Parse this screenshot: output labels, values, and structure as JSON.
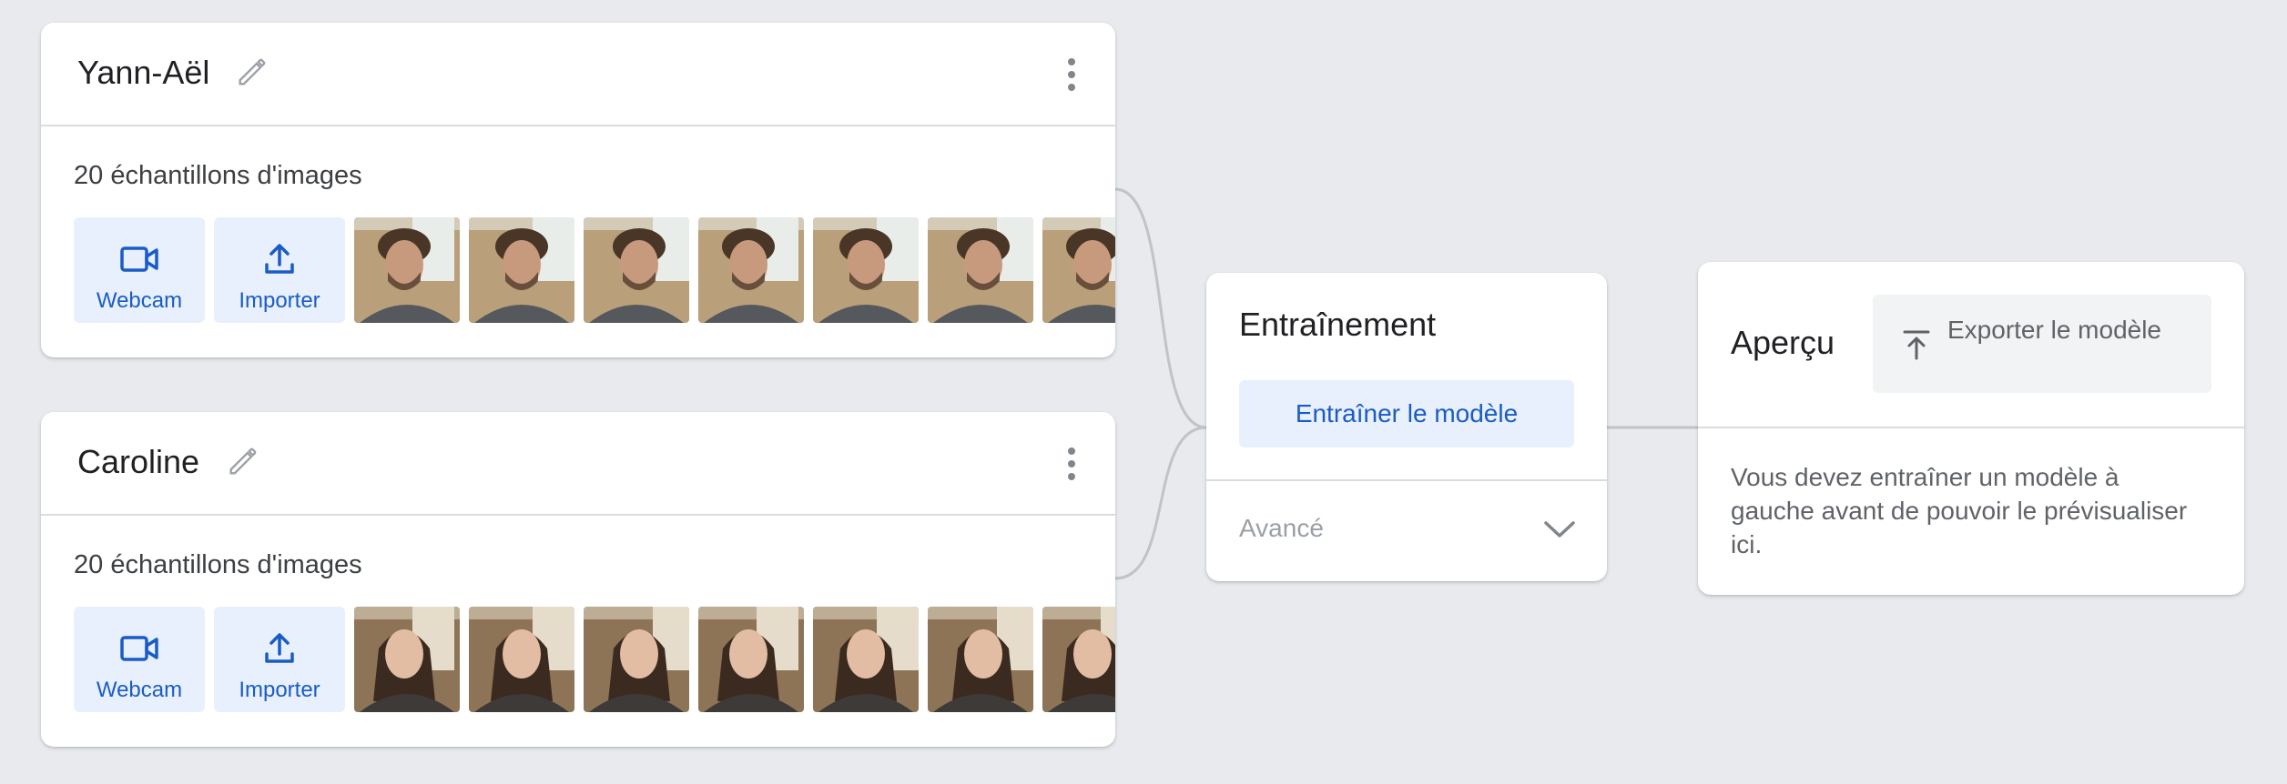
{
  "classes": [
    {
      "name": "Yann-Aël",
      "samples_label": "20 échantillons d'images",
      "webcam_label": "Webcam",
      "upload_label": "Importer",
      "thumb_count": 7,
      "thumb_palette": {
        "bg": "#b9a07a",
        "bg2": "#e9ede9",
        "skin": "#c79a7d",
        "hair": "#4a3626",
        "shirt": "#55585c"
      }
    },
    {
      "name": "Caroline",
      "samples_label": "20 échantillons d'images",
      "webcam_label": "Webcam",
      "upload_label": "Importer",
      "thumb_count": 7,
      "thumb_palette": {
        "bg": "#8e7456",
        "bg2": "#e6dccb",
        "skin": "#e2bda4",
        "hair": "#3b2a1f",
        "shirt": "#3d3a38"
      }
    }
  ],
  "training": {
    "title": "Entraînement",
    "train_button": "Entraîner le modèle",
    "advanced_label": "Avancé"
  },
  "preview": {
    "title": "Aperçu",
    "export_button": "Exporter le modèle",
    "message": "Vous devez entraîner un modèle à gauche avant de pouvoir le prévisualiser ici."
  },
  "icons": {
    "edit": "pencil-icon",
    "menu": "more-vert-icon",
    "webcam": "videocam-icon",
    "upload": "upload-icon",
    "export": "export-icon",
    "expand": "chevron-down-icon"
  },
  "colors": {
    "accent": "#1a5cc6",
    "accent_bg": "#e8f0fe",
    "page_bg": "#e8eaed",
    "divider": "#dadce0"
  }
}
